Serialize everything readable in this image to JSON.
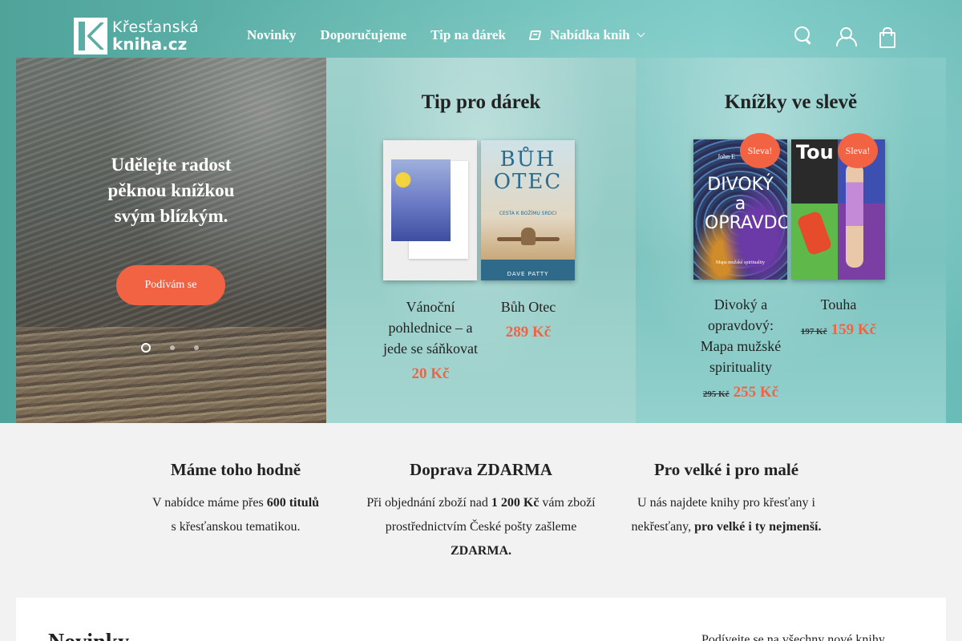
{
  "header": {
    "logo_line1": "Křesťanská",
    "logo_line2": "kniha.cz",
    "nav": [
      "Novinky",
      "Doporučujeme",
      "Tip na dárek",
      "Nabídka knih"
    ],
    "icons": [
      "search-icon",
      "account-icon",
      "bag-icon"
    ]
  },
  "hero": {
    "title": "Udělejte radost pěknou knížkou svým blízkým.",
    "button": "Podívám se",
    "slide_count": 3,
    "active_slide": 1
  },
  "gift": {
    "title": "Tip pro dárek",
    "products": [
      {
        "name": "Vánoční pohlednice – a jede se sáňkovat",
        "price": "20 Kč"
      },
      {
        "name": "Bůh Otec",
        "price": "289 Kč",
        "cover_title": "BŮH OTEC",
        "cover_subtitle": "CESTA K BOŽÍMU SRDCI",
        "cover_author": "DAVE PATTY"
      }
    ]
  },
  "sale": {
    "title": "Knížky ve slevě",
    "badge": "Sleva!",
    "products": [
      {
        "name": "Divoký a opravdový: Mapa mužské spirituality",
        "old_price": "295 Kč",
        "price": "255 Kč",
        "cover_author": "John E",
        "cover_title": "DIVOKÝ a OPRAVDOVÝ",
        "cover_subtitle": "Mapa mužské spirituality"
      },
      {
        "name": "Touha",
        "old_price": "197 Kč",
        "price": "159 Kč",
        "cover_title": "Tou"
      }
    ]
  },
  "features": [
    {
      "title": "Máme toho hodně",
      "text_a": "V nabídce máme přes ",
      "bold_a": "600 titulů",
      "text_b": "s křesťanskou tematikou."
    },
    {
      "title": "Doprava ZDARMA",
      "text_a": "Při objednání zboží nad ",
      "bold_a": "1 200 Kč",
      "text_b": " vám zboží prostřednictvím České pošty zašleme ",
      "bold_b": "ZDARMA."
    },
    {
      "title": "Pro velké i pro malé",
      "text_a": "U nás najdete knihy pro křesťany i nekřesťany, ",
      "bold_a": "pro velké i ty nejmenší."
    }
  ],
  "news": {
    "title": "Novinky",
    "link": "Podívejte se na všechny nové knihy"
  },
  "colors": {
    "accent": "#f26344",
    "teal": "#63b8b0"
  }
}
